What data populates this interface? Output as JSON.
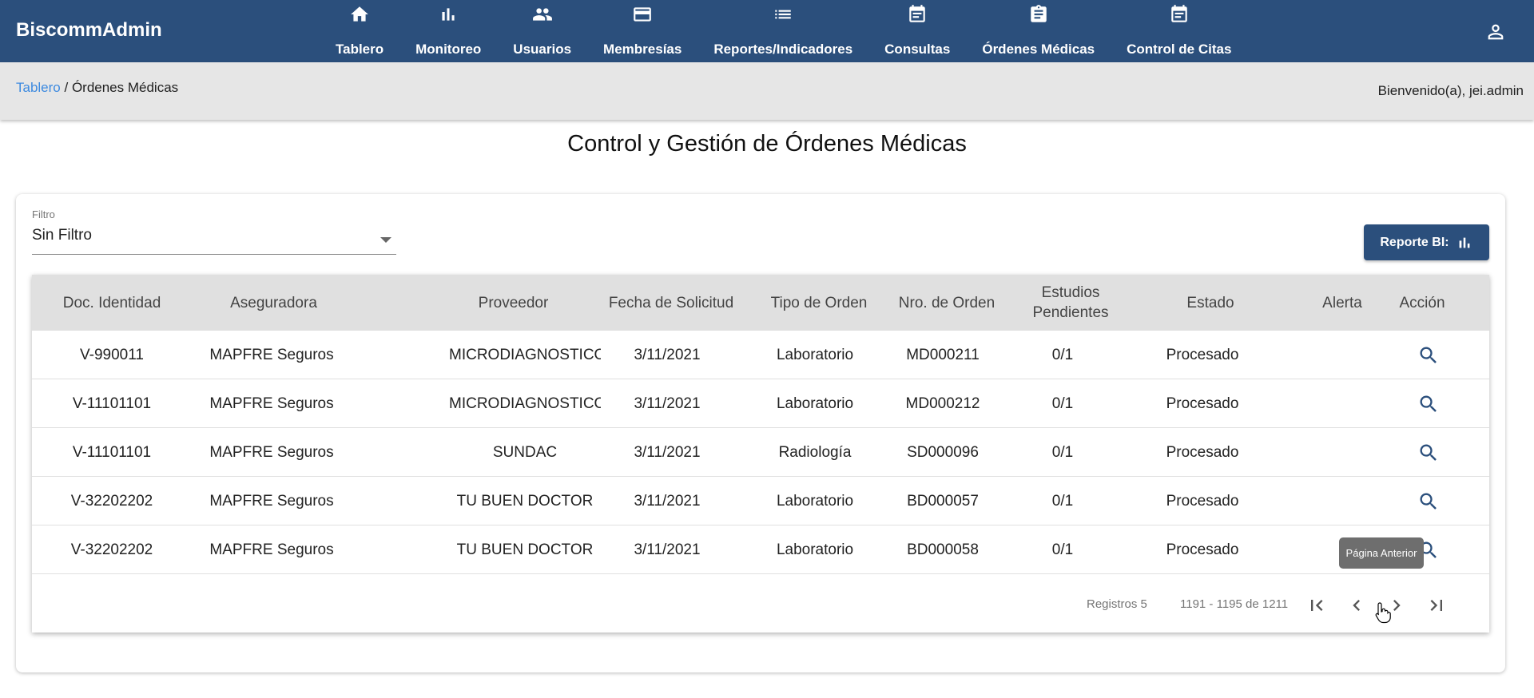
{
  "app": {
    "brand": "BiscommAdmin"
  },
  "nav": [
    {
      "label": "Tablero",
      "icon": "home-icon"
    },
    {
      "label": "Monitoreo",
      "icon": "bar-chart-icon"
    },
    {
      "label": "Usuarios",
      "icon": "people-icon"
    },
    {
      "label": "Membresías",
      "icon": "credit-card-icon"
    },
    {
      "label": "Reportes/Indicadores",
      "icon": "list-icon"
    },
    {
      "label": "Consultas",
      "icon": "event-note-icon"
    },
    {
      "label": "Órdenes Médicas",
      "icon": "assignment-icon"
    },
    {
      "label": "Control de Citas",
      "icon": "event-note-icon"
    }
  ],
  "breadcrumb": {
    "root": "Tablero",
    "separator": " / ",
    "current": "Órdenes Médicas"
  },
  "welcome": "Bienvenido(a), jei.admin",
  "page_title": "Control y Gestión de Órdenes Médicas",
  "filter": {
    "label": "Filtro",
    "value": "Sin Filtro"
  },
  "report_button": {
    "label": "Reporte BI:",
    "icon": "bar-chart-icon"
  },
  "table": {
    "headers": [
      "Doc. Identidad",
      "Aseguradora",
      "Proveedor",
      "Fecha de Solicitud",
      "Tipo de Orden",
      "Nro. de Orden",
      "Estudios Pendientes",
      "Estado",
      "Alerta",
      "Acción"
    ],
    "rows": [
      [
        "V-990011",
        "MAPFRE Seguros",
        "MICRODIAGNOSTICO",
        "3/11/2021",
        "Laboratorio",
        "MD000211",
        "0/1",
        "Procesado",
        "",
        "search-icon"
      ],
      [
        "V-11101101",
        "MAPFRE Seguros",
        "MICRODIAGNOSTICO",
        "3/11/2021",
        "Laboratorio",
        "MD000212",
        "0/1",
        "Procesado",
        "",
        "search-icon"
      ],
      [
        "V-11101101",
        "MAPFRE Seguros",
        "SUNDAC",
        "3/11/2021",
        "Radiología",
        "SD000096",
        "0/1",
        "Procesado",
        "",
        "search-icon"
      ],
      [
        "V-32202202",
        "MAPFRE Seguros",
        "TU BUEN DOCTOR",
        "3/11/2021",
        "Laboratorio",
        "BD000057",
        "0/1",
        "Procesado",
        "",
        "search-icon"
      ],
      [
        "V-32202202",
        "MAPFRE Seguros",
        "TU BUEN DOCTOR",
        "3/11/2021",
        "Laboratorio",
        "BD000058",
        "0/1",
        "Procesado",
        "",
        "search-icon"
      ]
    ]
  },
  "pager": {
    "records_label": "Registros 5",
    "range": "1191 - 1195 de 1211",
    "tooltip": "Página Anterior"
  },
  "colors": {
    "primary": "#2b4f7c",
    "link": "#3d8ae0",
    "header_bg": "#e0e0e0",
    "crumb_bg": "#e6e6e6"
  }
}
